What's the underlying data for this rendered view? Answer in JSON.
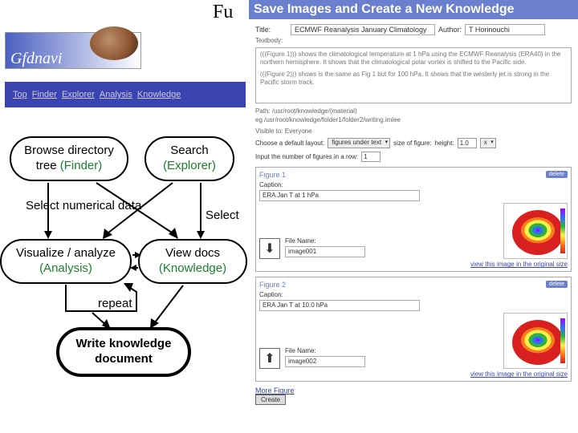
{
  "heading_fragment": "Fu",
  "app_name": "Gfdnavi",
  "nav": {
    "items": [
      "Top",
      "Finder",
      "Explorer",
      "Analysis",
      "Knowledge"
    ]
  },
  "diagram": {
    "browse": {
      "line1": "Browse directory",
      "line2_a": "tree ",
      "line2_b": "(Finder)"
    },
    "search": {
      "line1": "Search",
      "line2": "(Explorer)"
    },
    "select_numerical": "Select numerical data",
    "select": "Select",
    "visualize": {
      "line1": "Visualize / analyze",
      "line2": "(Analysis)"
    },
    "viewdocs": {
      "line1": "View docs",
      "line2": "(Knowledge)"
    },
    "repeat": "repeat",
    "write": {
      "line1": "Write knowledge",
      "line2": "document"
    }
  },
  "dialog": {
    "title": "Save Images and Create a New Knowledge",
    "labels": {
      "title": "Title:",
      "author": "Author:",
      "textbody": "Textbody:",
      "path": "Path:"
    },
    "title_value": "ECMWF Reanalysis January Climatology",
    "author_value": "T Horinouchi",
    "textbody_p1": "(((Figure 1))) shows the climatological temperature at 1 hPa using the ECMWF Reanalysis (ERA40) in the northern hemisphere. It shows that the climatological polar vortex is shifted to the Pacific side.",
    "textbody_p2": "(((Figure 2))) shows is the same as Fig 1 but for 100 hPa. It shows that the westerly jet is strong in the Pacific storm track.",
    "path_value": "/usr/root/knowledge/(material)",
    "path_eg": "eg /usr/root/knowledge/folder1/folder2/writing.imlee",
    "visible_to": "Visible to: Everyone",
    "layout_label": "Choose a default layout:",
    "layout_value": "figures under text",
    "size_label": "size of figure:",
    "height_label": "height:",
    "height_value": "1.0",
    "x_label": "x",
    "input_label": "Input the number of figures in a row:",
    "row_value": "1",
    "fig1": {
      "header": "Figure 1",
      "delete": "delete",
      "caption_label": "Caption:",
      "caption_value": "ERA Jan T at 1 hPa",
      "filename_label": "File Name:",
      "filename_value": "image001",
      "arrow": "down",
      "viewlink": "view this image in the original size"
    },
    "fig2": {
      "header": "Figure 2",
      "delete": "delete",
      "caption_label": "Caption:",
      "caption_value": "ERA Jan T at 10.0 hPa",
      "filename_label": "File Name:",
      "filename_value": "image002",
      "arrow": "up",
      "viewlink": "view this image in the original size"
    },
    "more": "More Figure",
    "create": "Create"
  }
}
